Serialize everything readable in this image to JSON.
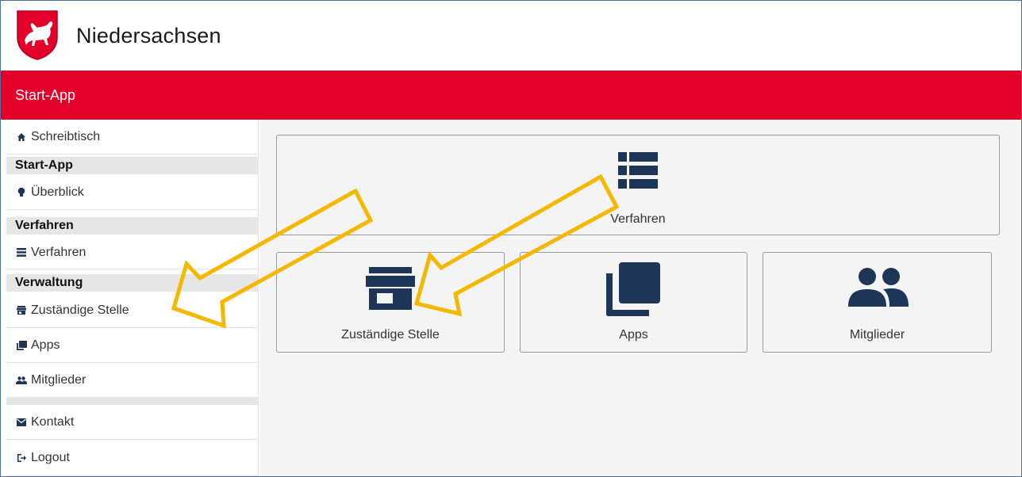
{
  "brand": {
    "name": "Niedersachsen",
    "logo_icon": "lower-saxony-horse-crest"
  },
  "header": {
    "title": "Start-App",
    "bar_color": "#e2002a"
  },
  "sidebar": {
    "desk": {
      "label": "Schreibtisch",
      "icon": "home-icon"
    },
    "groups": [
      {
        "heading": "Start-App",
        "items": [
          {
            "label": "Überblick",
            "icon": "lightbulb-icon"
          }
        ]
      },
      {
        "heading": "Verfahren",
        "items": [
          {
            "label": "Verfahren",
            "icon": "list-icon"
          }
        ]
      },
      {
        "heading": "Verwaltung",
        "items": [
          {
            "label": "Zuständige Stelle",
            "icon": "store-icon"
          },
          {
            "label": "Apps",
            "icon": "apps-icon"
          },
          {
            "label": "Mitglieder",
            "icon": "people-icon"
          }
        ]
      }
    ],
    "footer_items": [
      {
        "label": "Kontakt",
        "icon": "mail-icon"
      },
      {
        "label": "Logout",
        "icon": "logout-icon"
      }
    ]
  },
  "tiles": {
    "verfahren": {
      "label": "Verfahren",
      "icon": "list-icon"
    },
    "zustaendige_stelle": {
      "label": "Zuständige Stelle",
      "icon": "store-icon"
    },
    "apps": {
      "label": "Apps",
      "icon": "apps-icon"
    },
    "mitglieder": {
      "label": "Mitglieder",
      "icon": "people-icon"
    }
  },
  "colors": {
    "accent_red": "#e2002a",
    "icon_navy": "#1d3557",
    "annotation_arrow": "#f5b800"
  }
}
